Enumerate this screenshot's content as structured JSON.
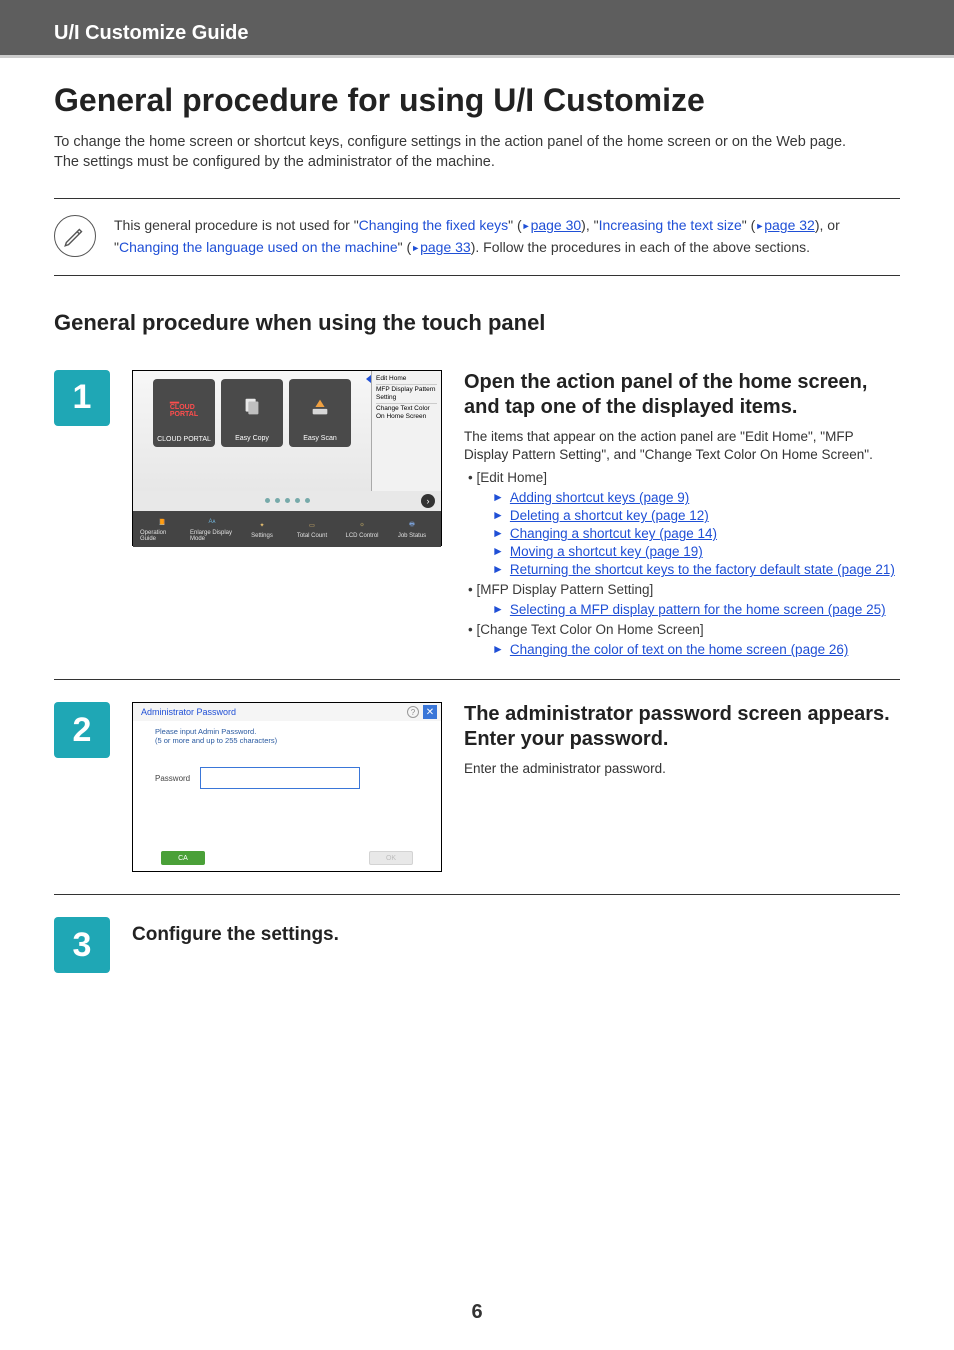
{
  "header": {
    "breadcrumb": "U/I Customize Guide"
  },
  "title": "General procedure for using U/I Customize",
  "intro": {
    "p1": "To change the home screen or shortcut keys, configure settings in the action panel of the home screen or on the Web page.",
    "p2": "The settings must be configured by the administrator of the machine."
  },
  "note": {
    "t1": "This general procedure is not used for \"",
    "l1": "Changing the fixed keys",
    "t2": "\" (",
    "pl1": "page 30",
    "t3": "), \"",
    "l2": "Increasing the text size",
    "t4": "\" (",
    "pl2": "page 32",
    "t5": "), or \"",
    "l3": "Changing the language used on the machine",
    "t6": "\" (",
    "pl3": "page 33",
    "t7": "). Follow the procedures in each of the above sections."
  },
  "section_title": "General procedure when using the touch panel",
  "steps": {
    "s1": {
      "num": "1",
      "heading": "Open the action panel of the home screen, and tap one of the displayed items.",
      "body": "The items that appear on the action panel are \"Edit Home\", \"MFP Display Pattern Setting\", and \"Change Text Color On Home Screen\".",
      "b1_label": "• [Edit Home]",
      "b1_links": {
        "a": "Adding shortcut keys (page 9)",
        "b": "Deleting a shortcut key (page 12)",
        "c": "Changing a shortcut key (page 14)",
        "d": "Moving a shortcut key (page 19)",
        "e": "Returning the shortcut keys to the factory default state (page 21)"
      },
      "b2_label": "• [MFP Display Pattern Setting]",
      "b2_links": {
        "a": "Selecting a MFP display pattern for the home screen (page 25)"
      },
      "b3_label": "• [Change Text Color On Home Screen]",
      "b3_links": {
        "a": "Changing the color of text on the home screen (page 26)"
      }
    },
    "s2": {
      "num": "2",
      "heading": "The administrator password screen appears. Enter your password.",
      "body": "Enter the administrator password."
    },
    "s3": {
      "num": "3",
      "heading": "Configure the settings."
    }
  },
  "mfp": {
    "side": {
      "l1": "Edit Home",
      "l2": "MFP Display Pattern Setting",
      "l3": "Change Text Color On Home Screen"
    },
    "tiles": {
      "t1a": "CLOUD",
      "t1b": "PORTAL",
      "t1c": "CLOUD PORTAL",
      "t2": "Easy Copy",
      "t3": "Easy Scan"
    },
    "bottom": {
      "b1": "Operation Guide",
      "b2": "Enlarge Display Mode",
      "b3": "Settings",
      "b4": "Total Count",
      "b5": "LCD Control",
      "b6": "Job Status"
    }
  },
  "pw": {
    "title": "Administrator Password",
    "note1": "Please input Admin Password.",
    "note2": "(5 or more and up to 255 characters)",
    "label": "Password",
    "ca": "CA",
    "ok": "OK",
    "x": "✕",
    "q": "?"
  },
  "page_number": "6"
}
